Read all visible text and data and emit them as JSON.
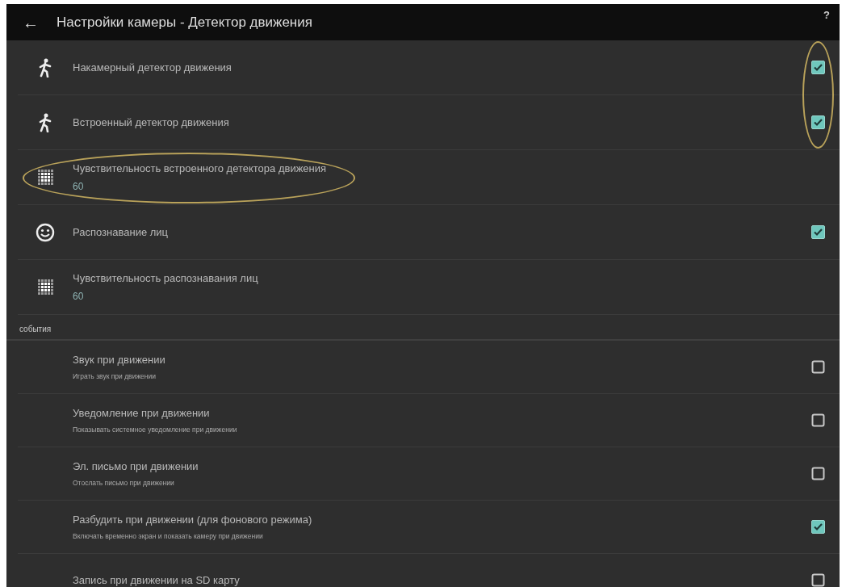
{
  "header": {
    "back": "←",
    "title": "Настройки камеры - Детектор движения",
    "help": "?"
  },
  "rows": [
    {
      "kind": "motion",
      "title": "Накамерный детектор движения",
      "checked": true,
      "circled": true
    },
    {
      "kind": "motion",
      "title": "Встроенный детектор движения",
      "checked": true,
      "circled": true
    },
    {
      "kind": "sensitivity",
      "title": "Чувствительность встроенного детектора движения",
      "value": "60",
      "circled": true
    },
    {
      "kind": "face",
      "title": "Распознавание лиц",
      "checked": true,
      "circled": false
    },
    {
      "kind": "sensitivity",
      "title": "Чувствительность распознавания лиц",
      "value": "60",
      "circled": false
    }
  ],
  "section": {
    "title": "события",
    "rows": [
      {
        "title": "Звук при движении",
        "subtitle": "Играть звук при движении",
        "checked": false
      },
      {
        "title": "Уведомление при движении",
        "subtitle": "Показывать системное уведомление при движении",
        "checked": false
      },
      {
        "title": "Эл. письмо при движении",
        "subtitle": "Отослать письмо при движении",
        "checked": false
      },
      {
        "title": "Разбудить при движении (для фонового режима)",
        "subtitle": "Включать временно экран и показать камеру при движении",
        "checked": true
      },
      {
        "title": "Запись при движении на SD карту",
        "checked": false
      }
    ]
  }
}
